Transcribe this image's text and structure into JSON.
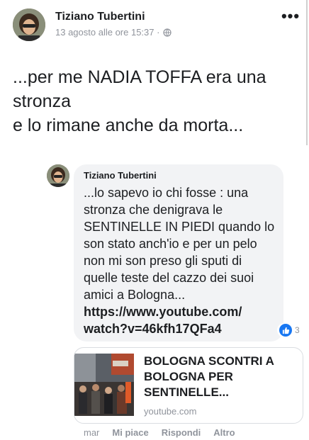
{
  "post": {
    "author": "Tiziano Tubertini",
    "timestamp": "13 agosto alle ore 15:37 ·",
    "text_lines": [
      "...per me NADIA TOFFA era una",
      "stronza",
      "e lo rimane anche da morta..."
    ],
    "more_label": "•••",
    "privacy_icon": "globe-icon"
  },
  "comment": {
    "author": "Tiziano Tubertini",
    "text": "...lo sapevo io chi fosse : una stronza che denigrava le SENTINELLE IN PIEDI quando lo son stato anch'io e per un pelo non mi son preso gli sputi di quelle teste del cazzo dei suoi amici a Bologna...",
    "link": "https://www.youtube.com/ watch?v=46kfh17QFa4",
    "reaction_count": "3",
    "reaction_icon": "like-icon"
  },
  "link_preview": {
    "title": "BOLOGNA SCONTRI A BOLOGNA PER SENTINELLE...",
    "domain": "youtube.com"
  },
  "actions": {
    "time": "mar",
    "like": "Mi piace",
    "reply": "Rispondi",
    "more": "Altro"
  },
  "colors": {
    "text": "#1c1e21",
    "secondary": "#90949c",
    "bubble": "#f2f3f5",
    "like_blue": "#1877f2"
  }
}
